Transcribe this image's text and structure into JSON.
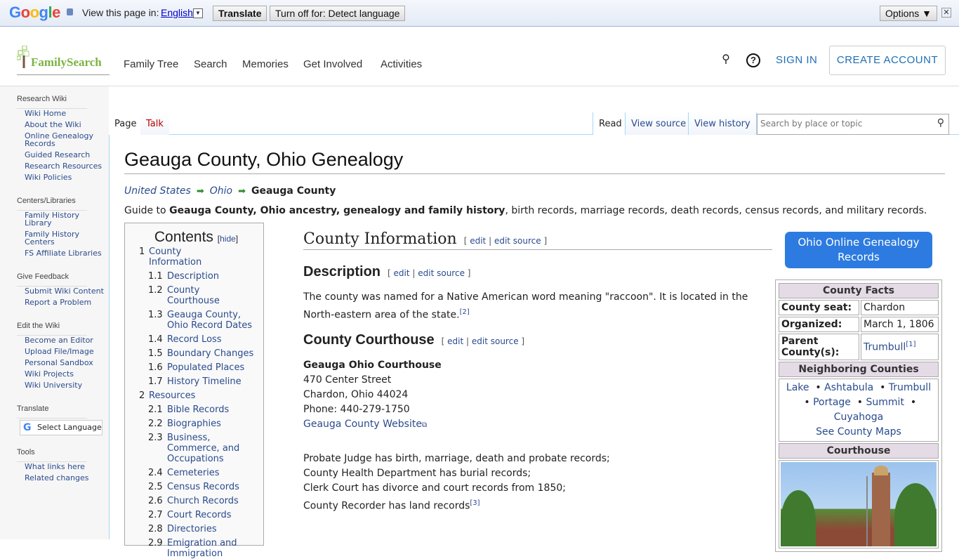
{
  "translate_bar": {
    "logo": "Google",
    "view_text": "View this page in:",
    "language": "English",
    "translate": "Translate",
    "turn_off": "Turn off for: Detect language",
    "options": "Options ▼",
    "close": "✕"
  },
  "header": {
    "logo": "FamilySearch",
    "nav": [
      "Family Tree",
      "Search",
      "Memories",
      "Get Involved",
      "Activities"
    ],
    "sign_in": "SIGN IN",
    "create_account": "CREATE ACCOUNT"
  },
  "sidebar": {
    "groups": [
      {
        "title": "Research Wiki",
        "items": [
          "Wiki Home",
          "About the Wiki",
          "Online Genealogy Records",
          "Guided Research",
          "Research Resources",
          "Wiki Policies"
        ]
      },
      {
        "title": "Centers/Libraries",
        "items": [
          "Family History Library",
          "Family History Centers",
          "FS Affiliate Libraries"
        ]
      },
      {
        "title": "Give Feedback",
        "items": [
          "Submit Wiki Content",
          "Report a Problem"
        ]
      },
      {
        "title": "Edit the Wiki",
        "items": [
          "Become an Editor",
          "Upload File/Image",
          "Personal Sandbox",
          "Wiki Projects",
          "Wiki University"
        ]
      }
    ],
    "translate_title": "Translate",
    "select_language": "Select Language",
    "tools_title": "Tools",
    "tools": [
      "What links here",
      "Related changes"
    ]
  },
  "tabs": {
    "page": "Page",
    "talk": "Talk",
    "read": "Read",
    "view_source": "View source",
    "view_history": "View history",
    "search_placeholder": "Search by place or topic"
  },
  "page": {
    "title": "Geauga County, Ohio Genealogy",
    "breadcrumb": [
      "United States",
      "Ohio",
      "Geauga County"
    ],
    "guide_prefix": "Guide to ",
    "guide_bold": "Geauga County, Ohio ancestry, genealogy and family history",
    "guide_rest": ", birth records, marriage records, death records, census records, and military records."
  },
  "toc": {
    "title": "Contents",
    "hide": "hide",
    "items": [
      {
        "n": "1",
        "t": "County Information",
        "l": 1
      },
      {
        "n": "1.1",
        "t": "Description",
        "l": 2
      },
      {
        "n": "1.2",
        "t": "County Courthouse",
        "l": 2
      },
      {
        "n": "1.3",
        "t": "Geauga County, Ohio Record Dates",
        "l": 2
      },
      {
        "n": "1.4",
        "t": "Record Loss",
        "l": 2
      },
      {
        "n": "1.5",
        "t": "Boundary Changes",
        "l": 2
      },
      {
        "n": "1.6",
        "t": "Populated Places",
        "l": 2
      },
      {
        "n": "1.7",
        "t": "History Timeline",
        "l": 2
      },
      {
        "n": "2",
        "t": "Resources",
        "l": 1
      },
      {
        "n": "2.1",
        "t": "Bible Records",
        "l": 2
      },
      {
        "n": "2.2",
        "t": "Biographies",
        "l": 2
      },
      {
        "n": "2.3",
        "t": "Business, Commerce, and Occupations",
        "l": 2
      },
      {
        "n": "2.4",
        "t": "Cemeteries",
        "l": 2
      },
      {
        "n": "2.5",
        "t": "Census Records",
        "l": 2
      },
      {
        "n": "2.6",
        "t": "Church Records",
        "l": 2
      },
      {
        "n": "2.7",
        "t": "Court Records",
        "l": 2
      },
      {
        "n": "2.8",
        "t": "Directories",
        "l": 2
      },
      {
        "n": "2.9",
        "t": "Emigration and Immigration",
        "l": 2
      }
    ]
  },
  "sections": {
    "edit": "edit",
    "edit_source": "edit source",
    "county_info": "County Information",
    "description": "Description",
    "desc_text": "The county was named for a Native American word meaning \"raccoon\". It is located in the North-eastern area of the state.",
    "desc_ref": "[2]",
    "courthouse": "County Courthouse",
    "ch_name": "Geauga Ohio Courthouse",
    "ch_lines": [
      "470 Center Street",
      "Chardon, Ohio 44024",
      "Phone: 440-279-1750"
    ],
    "ch_website": "Geauga County Website",
    "records": [
      "Probate Judge has birth, marriage, death and probate records;",
      "County Health Department has burial records;",
      "Clerk Court has divorce and court records from 1850;",
      "County Recorder has land records"
    ],
    "records_ref": "[3]"
  },
  "infobox": {
    "button": "Ohio Online Genealogy Records",
    "facts_title": "County Facts",
    "seat_label": "County seat:",
    "seat": "Chardon",
    "org_label": "Organized:",
    "org": "March 1, 1806",
    "parent_label": "Parent County(s):",
    "parent": "Trumbull",
    "parent_ref": "[1]",
    "neighbors_title": "Neighboring Counties",
    "neighbors": [
      "Lake",
      "Ashtabula",
      "Trumbull",
      "Portage",
      "Summit",
      "Cuyahoga"
    ],
    "maps": "See County Maps",
    "courthouse_title": "Courthouse"
  },
  "colors": {
    "accent": "#2d7be0",
    "link": "#2a4b8d",
    "brand": "#7cb342",
    "infobox_header": "#e4dbe6"
  }
}
